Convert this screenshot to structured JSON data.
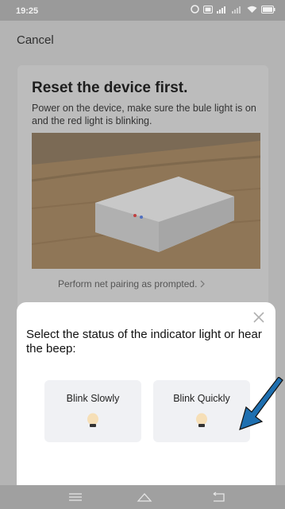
{
  "status_bar": {
    "time": "19:25",
    "icons": [
      "alarm-icon",
      "hd-icon",
      "signal-4g-icon",
      "signal-icon",
      "wifi-icon",
      "battery-icon"
    ]
  },
  "nav": {
    "cancel_label": "Cancel"
  },
  "background_card": {
    "title": "Reset the device first.",
    "description": "Power on the device, make sure the bule light is on and the red light is blinking.",
    "link_label": "Perform net pairing as prompted."
  },
  "sheet": {
    "title": "Select the status of the indicator light or hear the beep:",
    "options": [
      {
        "label": "Blink Slowly",
        "icon": "bulb-icon"
      },
      {
        "label": "Blink Quickly",
        "icon": "bulb-icon"
      }
    ]
  },
  "colors": {
    "overlay_gray": "#b4b4b4",
    "sheet_bg": "#ffffff",
    "option_bg": "#f0f1f4",
    "annotation_arrow": "#1e6fb0"
  }
}
